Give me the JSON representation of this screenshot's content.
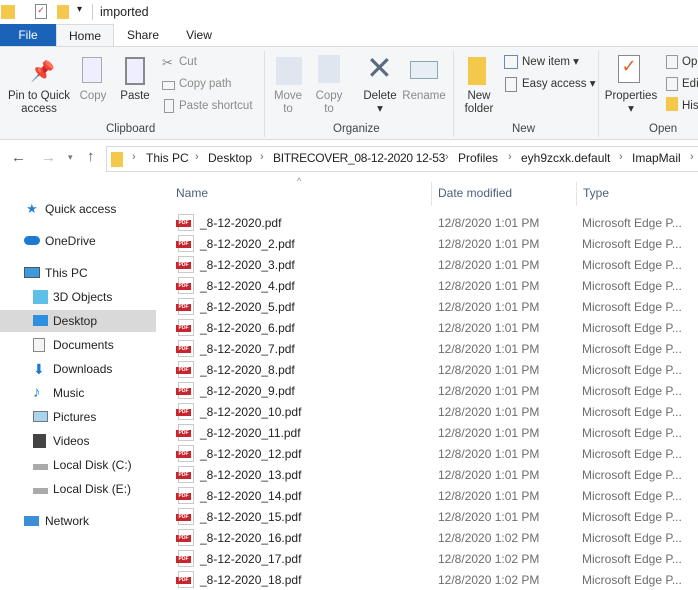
{
  "window": {
    "title": "imported"
  },
  "tabs": [
    "File",
    "Home",
    "Share",
    "View"
  ],
  "ribbon": {
    "clipboard": {
      "pin": "Pin to Quick access",
      "pin_l1": "Pin to Quick",
      "pin_l2": "access",
      "copy": "Copy",
      "paste": "Paste",
      "cut": "Cut",
      "copy_path": "Copy path",
      "paste_shortcut": "Paste shortcut",
      "group": "Clipboard"
    },
    "organize": {
      "move_l1": "Move",
      "move_l2": "to",
      "copy_l1": "Copy",
      "copy_l2": "to",
      "delete": "Delete",
      "rename": "Rename",
      "group": "Organize"
    },
    "new": {
      "new_folder_l1": "New",
      "new_folder_l2": "folder",
      "new_item": "New item",
      "easy_access": "Easy access",
      "group": "New"
    },
    "open": {
      "properties": "Properties",
      "open": "Op",
      "edit": "Edi",
      "history": "His",
      "group": "Open"
    }
  },
  "breadcrumb": [
    "This PC",
    "Desktop",
    "BITRECOVER_08-12-2020 12-53",
    "Profiles",
    "eyh9zcxk.default",
    "ImapMail"
  ],
  "sidebar": [
    {
      "label": "Quick access",
      "icon": "star-icon"
    },
    {
      "label": "OneDrive",
      "icon": "cloud-icon"
    },
    {
      "label": "This PC",
      "icon": "computer-icon"
    },
    {
      "label": "3D Objects",
      "icon": "cube-icon"
    },
    {
      "label": "Desktop",
      "icon": "desktop-icon",
      "selected": true
    },
    {
      "label": "Documents",
      "icon": "document-icon"
    },
    {
      "label": "Downloads",
      "icon": "download-icon"
    },
    {
      "label": "Music",
      "icon": "music-icon"
    },
    {
      "label": "Pictures",
      "icon": "picture-icon"
    },
    {
      "label": "Videos",
      "icon": "video-icon"
    },
    {
      "label": "Local Disk (C:)",
      "icon": "drive-icon"
    },
    {
      "label": "Local Disk (E:)",
      "icon": "drive-icon"
    },
    {
      "label": "Network",
      "icon": "network-icon"
    }
  ],
  "columns": {
    "name": "Name",
    "date": "Date modified",
    "type": "Type"
  },
  "files": [
    {
      "name": "_8-12-2020.pdf",
      "date": "12/8/2020 1:01 PM",
      "type": "Microsoft Edge P..."
    },
    {
      "name": "_8-12-2020_2.pdf",
      "date": "12/8/2020 1:01 PM",
      "type": "Microsoft Edge P..."
    },
    {
      "name": "_8-12-2020_3.pdf",
      "date": "12/8/2020 1:01 PM",
      "type": "Microsoft Edge P..."
    },
    {
      "name": "_8-12-2020_4.pdf",
      "date": "12/8/2020 1:01 PM",
      "type": "Microsoft Edge P..."
    },
    {
      "name": "_8-12-2020_5.pdf",
      "date": "12/8/2020 1:01 PM",
      "type": "Microsoft Edge P..."
    },
    {
      "name": "_8-12-2020_6.pdf",
      "date": "12/8/2020 1:01 PM",
      "type": "Microsoft Edge P..."
    },
    {
      "name": "_8-12-2020_7.pdf",
      "date": "12/8/2020 1:01 PM",
      "type": "Microsoft Edge P..."
    },
    {
      "name": "_8-12-2020_8.pdf",
      "date": "12/8/2020 1:01 PM",
      "type": "Microsoft Edge P..."
    },
    {
      "name": "_8-12-2020_9.pdf",
      "date": "12/8/2020 1:01 PM",
      "type": "Microsoft Edge P..."
    },
    {
      "name": "_8-12-2020_10.pdf",
      "date": "12/8/2020 1:01 PM",
      "type": "Microsoft Edge P..."
    },
    {
      "name": "_8-12-2020_11.pdf",
      "date": "12/8/2020 1:01 PM",
      "type": "Microsoft Edge P..."
    },
    {
      "name": "_8-12-2020_12.pdf",
      "date": "12/8/2020 1:01 PM",
      "type": "Microsoft Edge P..."
    },
    {
      "name": "_8-12-2020_13.pdf",
      "date": "12/8/2020 1:01 PM",
      "type": "Microsoft Edge P..."
    },
    {
      "name": "_8-12-2020_14.pdf",
      "date": "12/8/2020 1:01 PM",
      "type": "Microsoft Edge P..."
    },
    {
      "name": "_8-12-2020_15.pdf",
      "date": "12/8/2020 1:01 PM",
      "type": "Microsoft Edge P..."
    },
    {
      "name": "_8-12-2020_16.pdf",
      "date": "12/8/2020 1:02 PM",
      "type": "Microsoft Edge P..."
    },
    {
      "name": "_8-12-2020_17.pdf",
      "date": "12/8/2020 1:02 PM",
      "type": "Microsoft Edge P..."
    },
    {
      "name": "_8-12-2020_18.pdf",
      "date": "12/8/2020 1:02 PM",
      "type": "Microsoft Edge P..."
    }
  ],
  "colors": {
    "file_tab": "#1a63b8",
    "selected": "#d9d9d9",
    "pdf_red": "#c8252c",
    "folder": "#f4c84a"
  }
}
